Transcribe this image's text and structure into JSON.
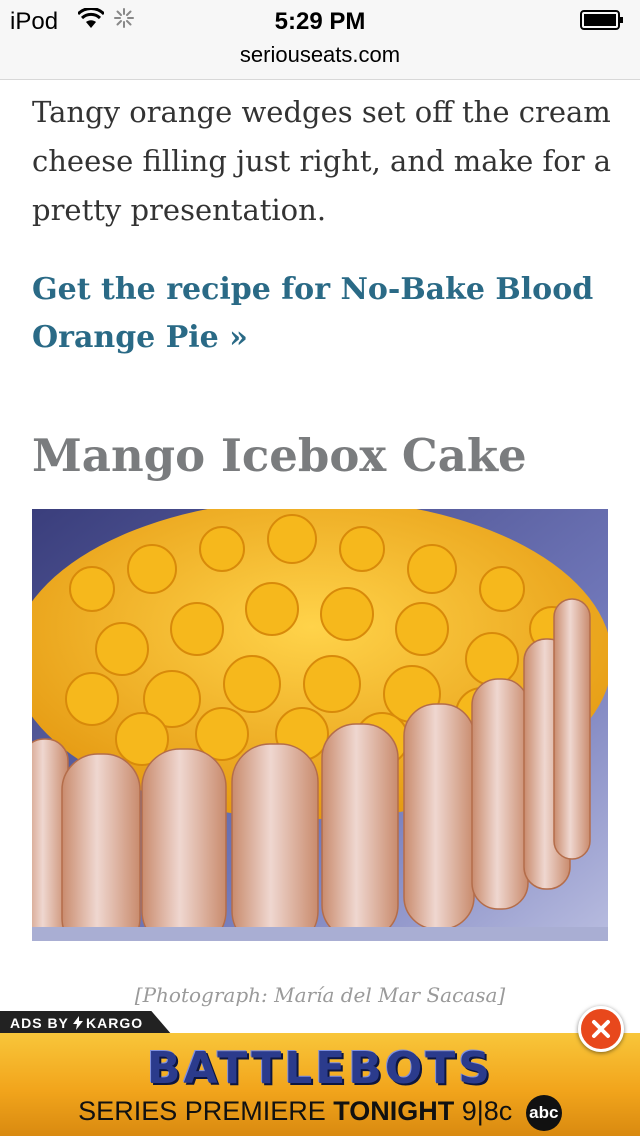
{
  "status_bar": {
    "carrier": "iPod",
    "time": "5:29 PM",
    "url": "seriouseats.com"
  },
  "article": {
    "intro_paragraph": "Tangy orange wedges set off the cream cheese filling just right, and make for a pretty presentation.",
    "recipe_link_label": "Get the recipe for No-Bake Blood Orange Pie »",
    "section_heading": "Mango Icebox Cake",
    "photo_caption": "[Photograph: María del Mar Sacasa]"
  },
  "ad": {
    "ads_by_label": "ADS BY",
    "network_label": "KARGO",
    "title": "BATTLEBOTS",
    "subtitle_pre": "SERIES PREMIERE ",
    "subtitle_bold": "TONIGHT",
    "subtitle_post": " 9|8c",
    "network_logo": "abc"
  },
  "colors": {
    "link": "#2a6a86",
    "heading": "#7a7c7e",
    "close_button": "#e8481c",
    "ad_title": "#2b3b8c"
  },
  "icons": [
    "wifi-icon",
    "loading-spinner-icon",
    "battery-icon",
    "bolt-icon",
    "close-icon"
  ]
}
